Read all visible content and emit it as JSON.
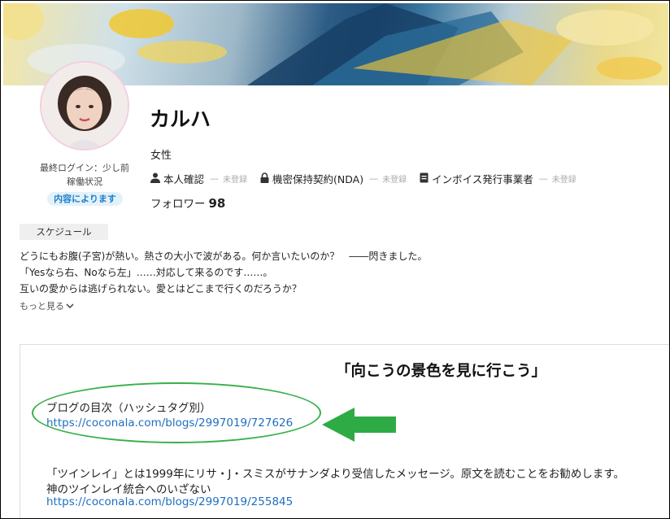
{
  "profile": {
    "name": "カルハ",
    "gender": "女性",
    "last_login": "最終ログイン：少し前",
    "work_status_label": "稼働状況",
    "work_status_badge": "内容によります",
    "followers_label": "フォロワー",
    "followers_count": "98"
  },
  "verifications": [
    {
      "icon": "person-icon",
      "label": "本人確認",
      "status": "未登録"
    },
    {
      "icon": "lock-icon",
      "label": "機密保持契約(NDA)",
      "status": "未登録"
    },
    {
      "icon": "document-icon",
      "label": "インボイス発行事業者",
      "status": "未登録"
    }
  ],
  "schedule_tab": "スケジュール",
  "intro": {
    "lines": [
      "どうにもお腹(子宮)が熱い。熱さの大小で波がある。何か言いたいのか？　――閃きました。",
      "「Yesなら右、Noなら左」……対応して来るのです……。",
      "互いの愛からは逃げられない。愛とはどこまで行くのだろうか？"
    ],
    "more_label": "もっと見る"
  },
  "blog": {
    "title": "「向こうの景色を見に行こう」",
    "index_label": "ブログの目次（ハッシュタグ別）",
    "index_link": "https://coconala.com/blogs/2997019/727626",
    "twin_text": "「ツインレイ」とは1999年にリサ・J・スミスがサナンダより受信したメッセージ。原文を読むことをお勧めします。",
    "twin_sub": "神のツインレイ統合へのいざない",
    "twin_link": "https://coconala.com/blogs/2997019/255845"
  },
  "colors": {
    "annotation_green": "#38b04a",
    "link_blue": "#1f6fc0",
    "badge_blue": "#1f7fc9"
  }
}
